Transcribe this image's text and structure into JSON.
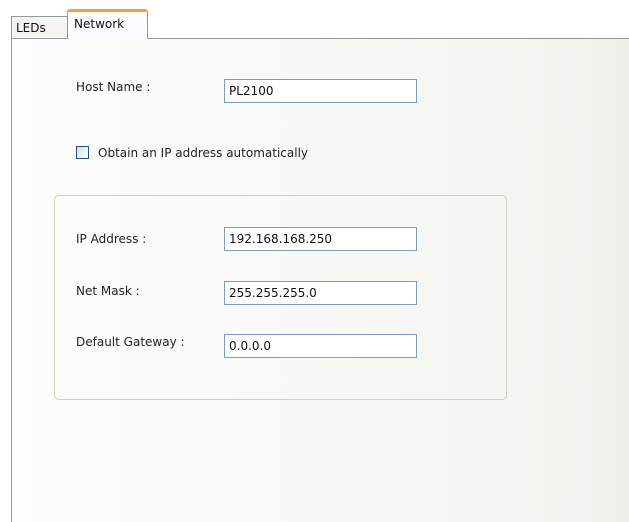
{
  "tabs": {
    "leds": "LEDs",
    "network": "Network"
  },
  "host": {
    "label": "Host Name :",
    "value": "PL2100"
  },
  "dhcp": {
    "label": "Obtain an IP address automatically",
    "checked": false
  },
  "ip": {
    "label": "IP Address :",
    "value": "192.168.168.250"
  },
  "netmask": {
    "label": "Net Mask :",
    "value": "255.255.255.0"
  },
  "gateway": {
    "label": "Default Gateway :",
    "value": "0.0.0.0"
  },
  "colors": {
    "active_tab_accent": "#f3a13a",
    "field_border": "#7f9db9"
  }
}
